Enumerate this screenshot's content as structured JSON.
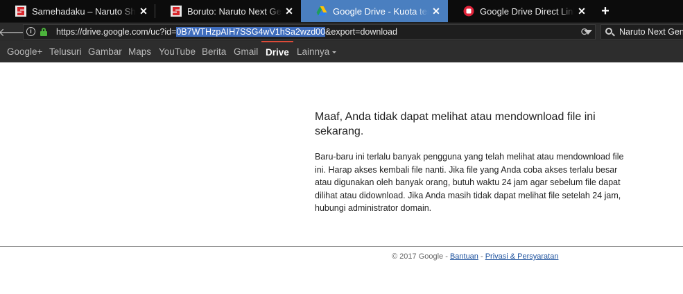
{
  "tabs": [
    {
      "title": "Samehadaku – Naruto Shippuden",
      "icon": "samehadaku-s-icon",
      "close": "✕"
    },
    {
      "title": "Boruto: Naruto Next Generations",
      "icon": "samehadaku-s-icon",
      "close": "✕"
    },
    {
      "title": "Google Drive - Kuota terlampaui",
      "icon": "google-drive-icon",
      "close": "✕",
      "active": true
    },
    {
      "title": "Google Drive Direct Link Generator",
      "icon": "red-circle-icon",
      "close": "✕"
    }
  ],
  "newtab_label": "+",
  "address": {
    "url_prefix": "https://drive.google.com/uc?id=",
    "url_highlight": "0B7WTHzpAIH7SSG4wV1hSa2wzd00",
    "url_suffix": "&export=download"
  },
  "search": {
    "value": "Naruto Next Generations"
  },
  "google_bar": {
    "items": [
      "Google+",
      "Telusuri",
      "Gambar",
      "Maps",
      "YouTube",
      "Berita",
      "Gmail",
      "Drive",
      "Lainnya"
    ],
    "active": "Drive"
  },
  "message": {
    "title": "Maaf, Anda tidak dapat melihat atau mendownload file ini sekarang.",
    "body": "Baru-baru ini terlalu banyak pengguna yang telah melihat atau mendownload file ini. Harap akses kembali file nanti. Jika file yang Anda coba akses terlalu besar atau digunakan oleh banyak orang, butuh waktu 24 jam agar sebelum file dapat dilihat atau didownload. Jika Anda masih tidak dapat melihat file setelah 24 jam, hubungi administrator domain."
  },
  "footer": {
    "copyright": "© 2017 Google - ",
    "help_link": "Bantuan",
    "separator": " - ",
    "privacy_link": "Privasi & Persyaratan"
  },
  "colors": {
    "active_tab": "#4a7fc0",
    "url_highlight": "#3f6dbd",
    "gbar_accent": "#dd4b39",
    "lock": "#4cb33c",
    "link": "#1a4f9c"
  }
}
